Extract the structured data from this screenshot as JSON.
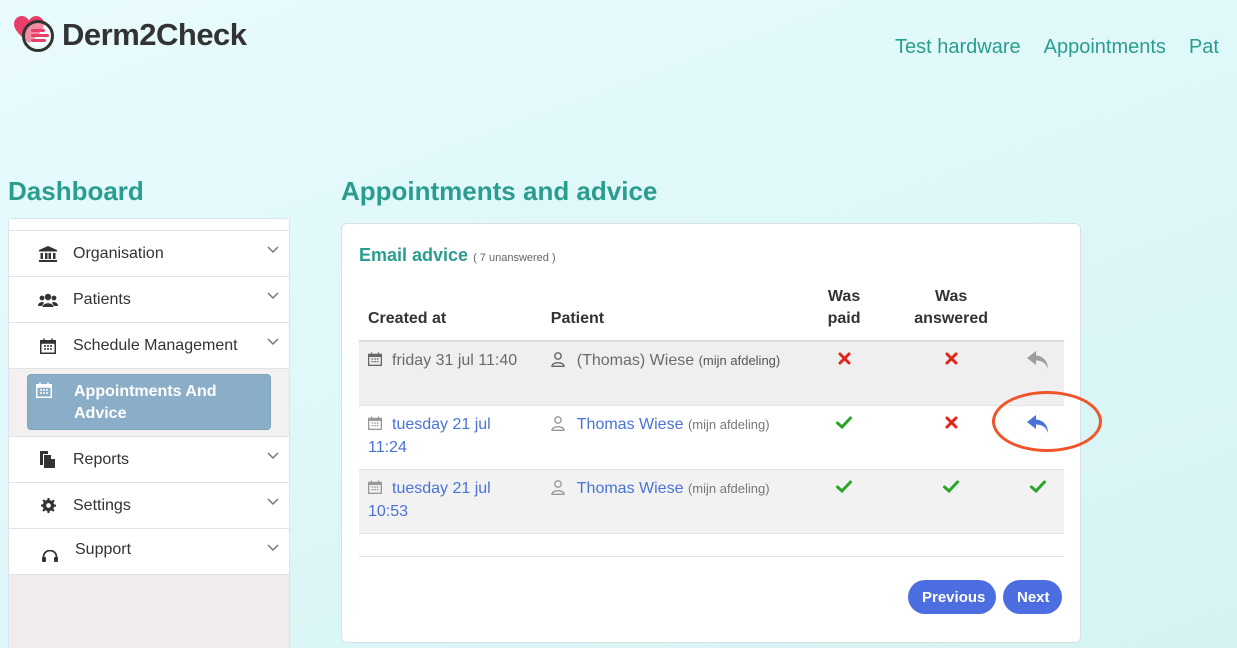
{
  "brand": {
    "name": "Derm2Check",
    "accent": "#2a9d8f",
    "logo_heart": "#e83e68"
  },
  "topnav": [
    {
      "label": "Test hardware"
    },
    {
      "label": "Appointments"
    },
    {
      "label": "Pat"
    }
  ],
  "sidebar": {
    "title": "Dashboard",
    "items": [
      {
        "label": "Organisation",
        "icon": "bank-icon"
      },
      {
        "label": "Patients",
        "icon": "users-icon"
      },
      {
        "label": "Schedule Management",
        "icon": "calendar-icon"
      },
      {
        "label": "Appointments And Advice",
        "icon": "calendar-icon",
        "active": true
      },
      {
        "label": "Reports",
        "icon": "reports-icon"
      },
      {
        "label": "Settings",
        "icon": "gear-icon"
      },
      {
        "label": "Support",
        "icon": "headset-icon"
      }
    ]
  },
  "main": {
    "title": "Appointments and advice",
    "card": {
      "title": "Email advice",
      "count": "( 7 unanswered )",
      "columns": [
        "Created at",
        "Patient",
        "Was paid",
        "Was answered",
        ""
      ],
      "rows": [
        {
          "date": "friday 31 jul 11:40",
          "patient": "(Thomas) Wiese",
          "dept": "(mijn afdeling)",
          "paid": "cross",
          "answered": "cross",
          "action": "reply-gray"
        },
        {
          "date": "tuesday 21 jul 11:24",
          "patient": "Thomas Wiese",
          "dept": "(mijn afdeling)",
          "paid": "check",
          "answered": "cross",
          "action": "reply-blue"
        },
        {
          "date": "tuesday 21 jul 10:53",
          "patient": "Thomas Wiese",
          "dept": "(mijn afdeling)",
          "paid": "check",
          "answered": "check",
          "action": "check"
        }
      ],
      "pager": {
        "previous": "Previous",
        "next": "Next"
      }
    }
  }
}
